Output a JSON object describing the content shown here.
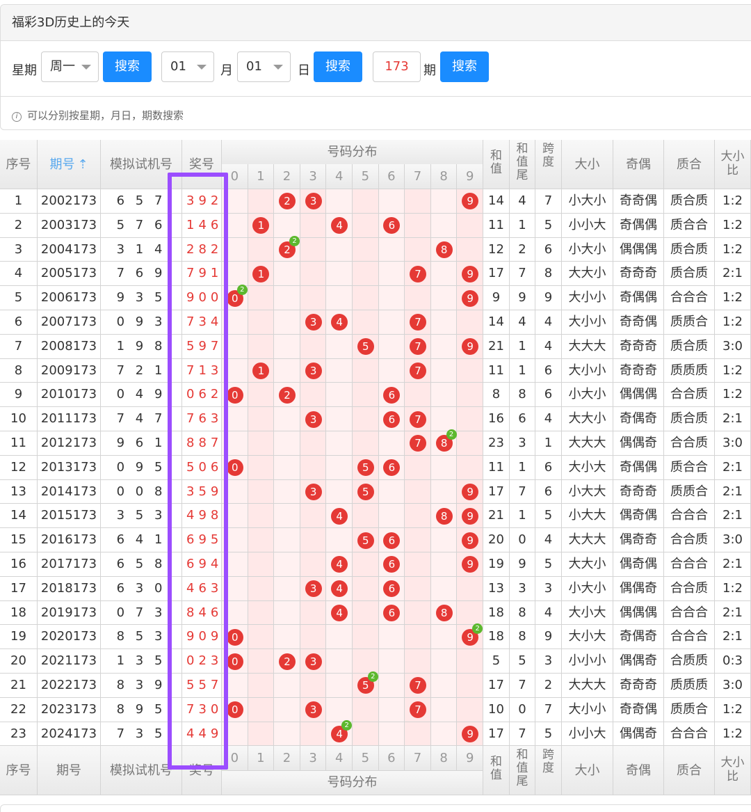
{
  "page_title": "福彩3D历史上的今天",
  "search": {
    "weekday_label": "星期",
    "weekday_value": "周一",
    "search_label": "搜索",
    "month_value": "01",
    "month_label": "月",
    "day_value": "01",
    "day_label": "日",
    "period_value": "173",
    "period_label": "期",
    "hint": "可以分别按星期，月日，期数搜索"
  },
  "table": {
    "headers": {
      "idx": "序号",
      "period": "期号",
      "sim": "模拟试机号",
      "draw": "奖号",
      "dist": "号码分布",
      "sum": "和值",
      "sum_tail": "和值尾",
      "span": "跨度",
      "big_small": "大小",
      "odd_even": "奇偶",
      "prime": "质合",
      "ratio": "大小比"
    },
    "digits": [
      "0",
      "1",
      "2",
      "3",
      "4",
      "5",
      "6",
      "7",
      "8",
      "9"
    ],
    "rows": [
      {
        "idx": "1",
        "period": "2002173",
        "sim": "6 5 7",
        "draw": "392",
        "sum": "14",
        "tail": "4",
        "span": "7",
        "bs": "小大小",
        "oe": "奇奇偶",
        "pc": "质合质",
        "ratio": "1:2"
      },
      {
        "idx": "2",
        "period": "2003173",
        "sim": "5 7 6",
        "draw": "146",
        "sum": "11",
        "tail": "1",
        "span": "5",
        "bs": "小小大",
        "oe": "奇偶偶",
        "pc": "质合合",
        "ratio": "1:2"
      },
      {
        "idx": "3",
        "period": "2004173",
        "sim": "3 1 4",
        "draw": "282",
        "sum": "12",
        "tail": "2",
        "span": "6",
        "bs": "小大小",
        "oe": "偶偶偶",
        "pc": "质合质",
        "ratio": "1:2"
      },
      {
        "idx": "4",
        "period": "2005173",
        "sim": "7 6 9",
        "draw": "791",
        "sum": "17",
        "tail": "7",
        "span": "8",
        "bs": "大大小",
        "oe": "奇奇奇",
        "pc": "质合质",
        "ratio": "2:1"
      },
      {
        "idx": "5",
        "period": "2006173",
        "sim": "9 3 5",
        "draw": "900",
        "sum": "9",
        "tail": "9",
        "span": "9",
        "bs": "大小小",
        "oe": "奇偶偶",
        "pc": "合合合",
        "ratio": "1:2"
      },
      {
        "idx": "6",
        "period": "2007173",
        "sim": "0 9 3",
        "draw": "734",
        "sum": "14",
        "tail": "4",
        "span": "4",
        "bs": "大小小",
        "oe": "奇奇偶",
        "pc": "质质合",
        "ratio": "1:2"
      },
      {
        "idx": "7",
        "period": "2008173",
        "sim": "1 9 8",
        "draw": "597",
        "sum": "21",
        "tail": "1",
        "span": "4",
        "bs": "大大大",
        "oe": "奇奇奇",
        "pc": "质合质",
        "ratio": "3:0"
      },
      {
        "idx": "8",
        "period": "2009173",
        "sim": "7 2 1",
        "draw": "713",
        "sum": "11",
        "tail": "1",
        "span": "6",
        "bs": "大小小",
        "oe": "奇奇奇",
        "pc": "质质质",
        "ratio": "1:2"
      },
      {
        "idx": "9",
        "period": "2010173",
        "sim": "0 4 9",
        "draw": "062",
        "sum": "8",
        "tail": "8",
        "span": "6",
        "bs": "小大小",
        "oe": "偶偶偶",
        "pc": "合合质",
        "ratio": "1:2"
      },
      {
        "idx": "10",
        "period": "2011173",
        "sim": "7 4 7",
        "draw": "763",
        "sum": "16",
        "tail": "6",
        "span": "4",
        "bs": "大大小",
        "oe": "奇偶奇",
        "pc": "质合质",
        "ratio": "2:1"
      },
      {
        "idx": "11",
        "period": "2012173",
        "sim": "9 6 1",
        "draw": "887",
        "sum": "23",
        "tail": "3",
        "span": "1",
        "bs": "大大大",
        "oe": "偶偶奇",
        "pc": "合合质",
        "ratio": "3:0"
      },
      {
        "idx": "12",
        "period": "2013173",
        "sim": "0 9 5",
        "draw": "506",
        "sum": "11",
        "tail": "1",
        "span": "6",
        "bs": "大小大",
        "oe": "奇偶偶",
        "pc": "质合合",
        "ratio": "2:1"
      },
      {
        "idx": "13",
        "period": "2014173",
        "sim": "0 0 8",
        "draw": "359",
        "sum": "17",
        "tail": "7",
        "span": "6",
        "bs": "小大大",
        "oe": "奇奇奇",
        "pc": "质质合",
        "ratio": "2:1"
      },
      {
        "idx": "14",
        "period": "2015173",
        "sim": "3 5 3",
        "draw": "498",
        "sum": "21",
        "tail": "1",
        "span": "5",
        "bs": "小大大",
        "oe": "偶奇偶",
        "pc": "合合合",
        "ratio": "2:1"
      },
      {
        "idx": "15",
        "period": "2016173",
        "sim": "6 4 1",
        "draw": "695",
        "sum": "20",
        "tail": "0",
        "span": "4",
        "bs": "大大大",
        "oe": "偶奇奇",
        "pc": "合合质",
        "ratio": "3:0"
      },
      {
        "idx": "16",
        "period": "2017173",
        "sim": "6 5 8",
        "draw": "694",
        "sum": "19",
        "tail": "9",
        "span": "5",
        "bs": "大大小",
        "oe": "偶奇偶",
        "pc": "合合合",
        "ratio": "2:1"
      },
      {
        "idx": "17",
        "period": "2018173",
        "sim": "6 3 0",
        "draw": "463",
        "sum": "13",
        "tail": "3",
        "span": "3",
        "bs": "小大小",
        "oe": "偶偶奇",
        "pc": "合合质",
        "ratio": "1:2"
      },
      {
        "idx": "18",
        "period": "2019173",
        "sim": "0 7 3",
        "draw": "846",
        "sum": "18",
        "tail": "8",
        "span": "4",
        "bs": "大小大",
        "oe": "偶偶偶",
        "pc": "合合合",
        "ratio": "2:1"
      },
      {
        "idx": "19",
        "period": "2020173",
        "sim": "8 5 3",
        "draw": "909",
        "sum": "18",
        "tail": "8",
        "span": "9",
        "bs": "大小大",
        "oe": "奇偶奇",
        "pc": "合合合",
        "ratio": "2:1"
      },
      {
        "idx": "20",
        "period": "2021173",
        "sim": "1 3 5",
        "draw": "023",
        "sum": "5",
        "tail": "5",
        "span": "3",
        "bs": "小小小",
        "oe": "偶偶奇",
        "pc": "合质质",
        "ratio": "0:3"
      },
      {
        "idx": "21",
        "period": "2022173",
        "sim": "8 3 9",
        "draw": "557",
        "sum": "17",
        "tail": "7",
        "span": "2",
        "bs": "大大大",
        "oe": "奇奇奇",
        "pc": "质质质",
        "ratio": "3:0"
      },
      {
        "idx": "22",
        "period": "2023173",
        "sim": "8 9 5",
        "draw": "730",
        "sum": "10",
        "tail": "0",
        "span": "7",
        "bs": "大小小",
        "oe": "奇奇偶",
        "pc": "质质合",
        "ratio": "1:2"
      },
      {
        "idx": "23",
        "period": "2024173",
        "sim": "7 3 5",
        "draw": "449",
        "sum": "17",
        "tail": "7",
        "span": "5",
        "bs": "小小大",
        "oe": "偶偶奇",
        "pc": "合合合",
        "ratio": "1:2"
      }
    ]
  },
  "colors": {
    "accent": "#1a8cff",
    "ball": "#e53935",
    "badge": "#5cb82e",
    "highlight": "#9b4dff",
    "dist_bg": "#fff1f1"
  }
}
